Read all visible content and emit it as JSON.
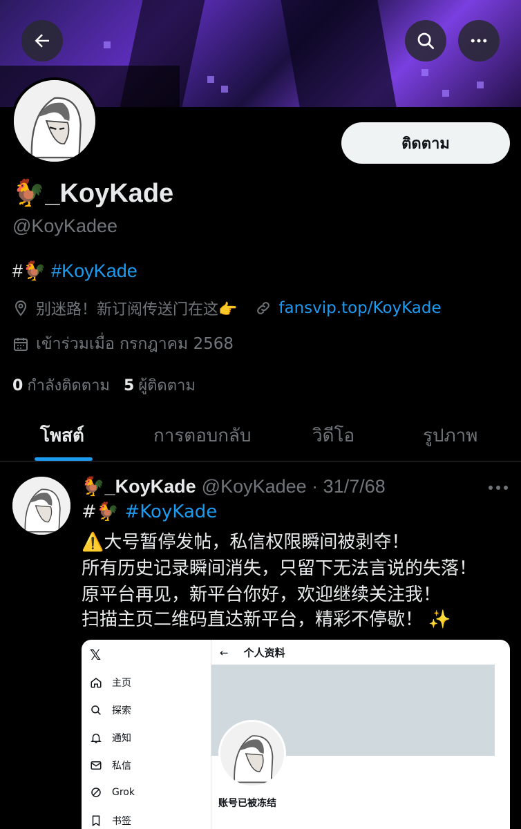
{
  "profile": {
    "follow_label": "ติดตาม",
    "display_name": "🐓_KoyKade",
    "handle": "@KoyKadee",
    "bio_prefix": "#🐓 ",
    "bio_tag": "#KoyKade",
    "location": "别迷路！新订阅传送门在这👉",
    "link": "fansvip.top/KoyKade",
    "joined": "เข้าร่วมเมื่อ กรกฎาคม 2568",
    "following_count": "0",
    "following_label": "กำลังติดตาม",
    "followers_count": "5",
    "followers_label": "ผู้ติดตาม"
  },
  "tabs": [
    {
      "label": "โพสต์"
    },
    {
      "label": "การตอบกลับ"
    },
    {
      "label": "วิดีโอ"
    },
    {
      "label": "รูปภาพ"
    }
  ],
  "post": {
    "name": "🐓_KoyKade",
    "handle_date": "@KoyKadee · 31/7/68",
    "line1_prefix": "#🐓 ",
    "line1_tag": "#KoyKade",
    "line2": "⚠️大号暂停发帖，私信权限瞬间被剥夺！",
    "line3": "所有历史记录瞬间消失，只留下无法言说的失落！",
    "line4": "原平台再见，新平台你好，欢迎继续关注我！",
    "line5": "扫描主页二维码直达新平台，精彩不停歇！ ✨"
  },
  "embed": {
    "logo": "𝕏",
    "nav": [
      "主页",
      "探索",
      "通知",
      "私信",
      "Grok",
      "书签"
    ],
    "back": "←",
    "title": "个人资料",
    "frozen": "账号已被冻结"
  }
}
